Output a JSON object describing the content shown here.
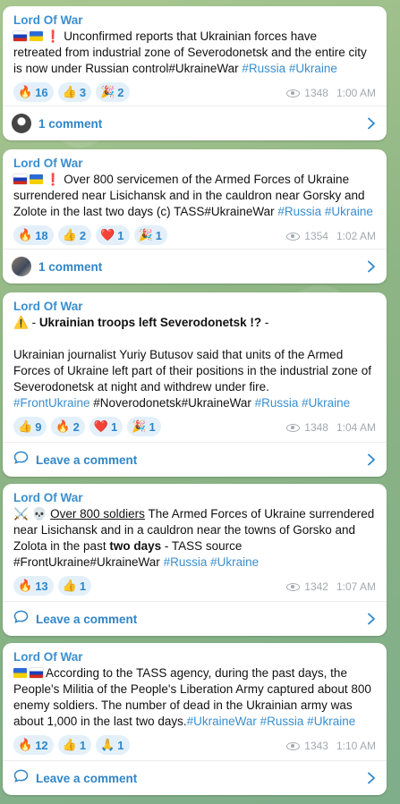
{
  "channel": "Lord Of War",
  "posts": [
    {
      "author": "Lord Of War",
      "lines": [
        {
          "segs": [
            {
              "t": "Unconfirmed reports that Ukrainian forces have"
            }
          ]
        },
        {
          "segs": [
            {
              "t": "retreated from industrial zone of Severodonetsk and the entire city"
            }
          ]
        },
        {
          "segs": [
            {
              "t": "is now under Russian control#UkraineWar "
            },
            {
              "t": "#Russia #Ukraine",
              "c": "tag"
            }
          ]
        }
      ],
      "prefix": [
        "ru",
        "ua",
        "excl"
      ],
      "reactions": [
        {
          "emoji": "🔥",
          "count": "16"
        },
        {
          "emoji": "👍",
          "count": "3"
        },
        {
          "emoji": "🎉",
          "count": "2"
        }
      ],
      "views": "1348",
      "time": "1:00 AM",
      "comment": "1 comment",
      "comment_type": "avatar"
    },
    {
      "author": "Lord Of War",
      "lines": [
        {
          "segs": [
            {
              "t": "Over 800 servicemen of the Armed Forces of Ukraine"
            }
          ]
        },
        {
          "segs": [
            {
              "t": "surrendered near Lisichansk and in the cauldron near Gorsky and"
            }
          ]
        },
        {
          "segs": [
            {
              "t": "Zolote in the last two days (c) TASS#UkraineWar "
            },
            {
              "t": "#Russia #Ukraine",
              "c": "tag"
            }
          ]
        }
      ],
      "prefix": [
        "ru",
        "ua",
        "excl"
      ],
      "reactions": [
        {
          "emoji": "🔥",
          "count": "18"
        },
        {
          "emoji": "👍",
          "count": "2"
        },
        {
          "emoji": "❤️",
          "count": "1"
        },
        {
          "emoji": "🎉",
          "count": "1"
        }
      ],
      "views": "1354",
      "time": "1:02 AM",
      "comment": "1 comment",
      "comment_type": "avatar"
    },
    {
      "author": "Lord Of War",
      "lines": [
        {
          "segs": [
            {
              "t": "⚠️ ",
              "c": "emo"
            },
            {
              "t": "- "
            },
            {
              "t": "Ukrainian troops left Severodonetsk !?",
              "c": "b"
            },
            {
              "t": " -"
            }
          ]
        },
        {
          "gap": true
        },
        {
          "segs": [
            {
              "t": "Ukrainian journalist Yuriy Butusov said that units of the Armed"
            }
          ]
        },
        {
          "segs": [
            {
              "t": "Forces of Ukraine left part of their positions in the industrial zone of"
            }
          ]
        },
        {
          "segs": [
            {
              "t": "Severodonetsk at night and withdrew under fire."
            }
          ]
        },
        {
          "segs": [
            {
              "t": "#FrontUkraine",
              "c": "tag"
            },
            {
              "t": " #Noverodonetsk#UkraineWar "
            },
            {
              "t": "#Russia #Ukraine",
              "c": "tag"
            }
          ]
        }
      ],
      "prefix": [],
      "reactions": [
        {
          "emoji": "👍",
          "count": "9"
        },
        {
          "emoji": "🔥",
          "count": "2"
        },
        {
          "emoji": "❤️",
          "count": "1"
        },
        {
          "emoji": "🎉",
          "count": "1"
        }
      ],
      "views": "1348",
      "time": "1:04 AM",
      "comment": "Leave a comment",
      "comment_type": "bubble"
    },
    {
      "author": "Lord Of War",
      "lines": [
        {
          "segs": [
            {
              "t": "⚔️ 💀 ",
              "c": "emo"
            },
            {
              "t": "Over 800 soldiers",
              "c": "u"
            },
            {
              "t": " The Armed Forces of Ukraine surrendered"
            }
          ]
        },
        {
          "segs": [
            {
              "t": "near Lisichansk and in a cauldron near the towns of Gorsko and"
            }
          ]
        },
        {
          "segs": [
            {
              "t": "Zolota in the past  "
            },
            {
              "t": "two days",
              "c": "b"
            },
            {
              "t": "  - TASS source"
            }
          ]
        },
        {
          "segs": [
            {
              "t": "#FrontUkraine#UkraineWar "
            },
            {
              "t": "#Russia #Ukraine",
              "c": "tag"
            }
          ]
        }
      ],
      "prefix": [],
      "reactions": [
        {
          "emoji": "🔥",
          "count": "13"
        },
        {
          "emoji": "👍",
          "count": "1"
        }
      ],
      "views": "1342",
      "time": "1:07 AM",
      "comment": "Leave a comment",
      "comment_type": "bubble"
    },
    {
      "author": "Lord Of War",
      "lines": [
        {
          "segs": [
            {
              "t": "According to the TASS agency, during the past days, the"
            }
          ]
        },
        {
          "segs": [
            {
              "t": "People's Militia of the People's Liberation Army captured about 800"
            }
          ]
        },
        {
          "segs": [
            {
              "t": "enemy soldiers. The number of dead in the Ukrainian army was"
            }
          ]
        },
        {
          "segs": [
            {
              "t": "about 1,000 in the last two days."
            },
            {
              "t": "#UkraineWar #Russia #Ukraine",
              "c": "tag"
            }
          ]
        }
      ],
      "prefix": [
        "ua",
        "ru"
      ],
      "reactions": [
        {
          "emoji": "🔥",
          "count": "12"
        },
        {
          "emoji": "👍",
          "count": "1"
        },
        {
          "emoji": "🙏",
          "count": "1"
        }
      ],
      "views": "1343",
      "time": "1:10 AM",
      "comment": "Leave a comment",
      "comment_type": "bubble"
    }
  ]
}
